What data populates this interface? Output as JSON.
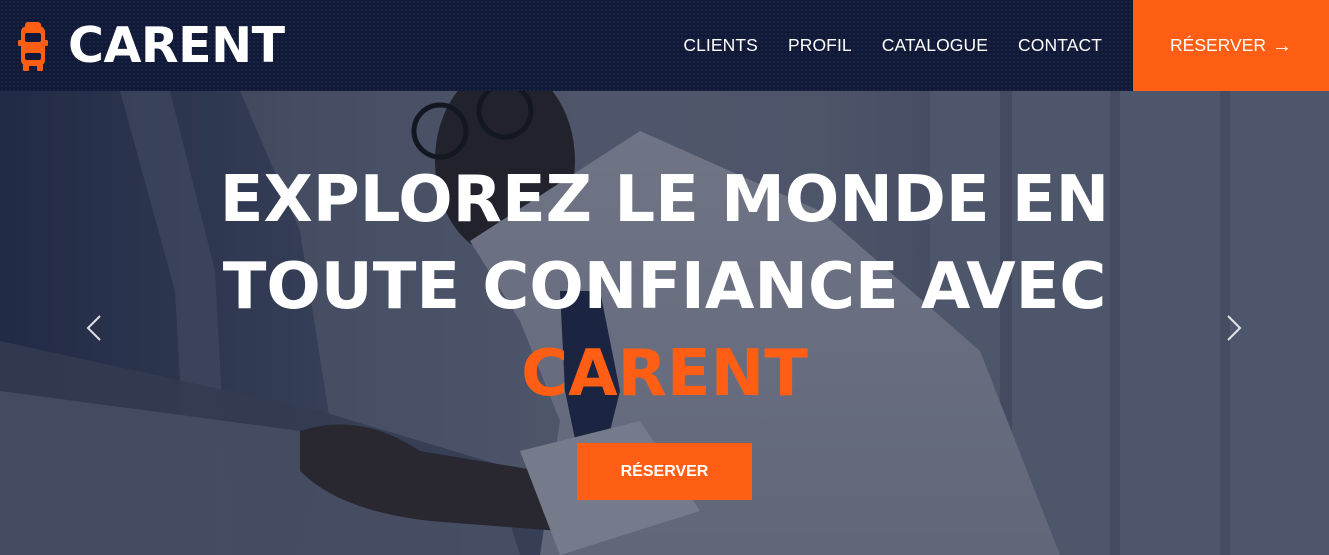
{
  "brand": {
    "name": "CARENT",
    "icon": "car-front-icon",
    "accent_color": "#ff5e14",
    "nav_bg_color": "#101a38"
  },
  "nav": {
    "links": [
      {
        "label": "CLIENTS"
      },
      {
        "label": "PROFIL"
      },
      {
        "label": "CATALOGUE"
      },
      {
        "label": "CONTACT"
      }
    ],
    "cta_label": "RÉSERVER",
    "cta_icon": "arrow-right-icon",
    "cta_arrow": "→"
  },
  "hero": {
    "title_line1": "EXPLOREZ LE MONDE EN",
    "title_line2": "TOUTE CONFIANCE AVEC",
    "title_accent": "CARENT",
    "button_label": "RÉSERVER",
    "prev_icon": "chevron-left-icon",
    "next_icon": "chevron-right-icon",
    "background_image": "man-with-glasses-leaning-on-car-photo"
  }
}
